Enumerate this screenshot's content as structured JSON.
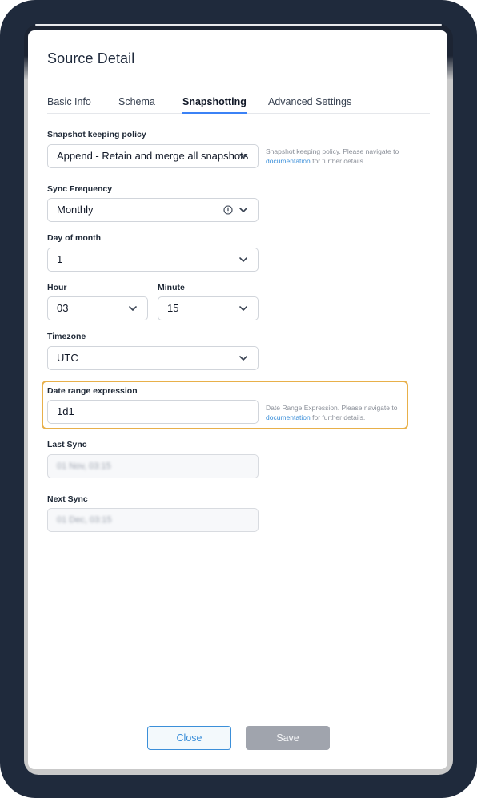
{
  "modal": {
    "title": "Source Detail",
    "tabs": [
      {
        "label": "Basic Info",
        "active": false
      },
      {
        "label": "Schema",
        "active": false
      },
      {
        "label": "Snapshotting",
        "active": true
      },
      {
        "label": "Advanced Settings",
        "active": false
      }
    ]
  },
  "form": {
    "snapshot_policy": {
      "label": "Snapshot keeping policy",
      "value": "Append - Retain and merge all snapshots",
      "help_text": "Snapshot keeping policy. Please navigate to",
      "help_link": "documentation",
      "help_suffix": " for further details."
    },
    "sync_frequency": {
      "label": "Sync Frequency",
      "value": "Monthly",
      "icon": "info-circle-icon"
    },
    "day_of_month": {
      "label": "Day of month",
      "value": "1"
    },
    "hour": {
      "label": "Hour",
      "value": "03"
    },
    "minute": {
      "label": "Minute",
      "value": "15"
    },
    "timezone": {
      "label": "Timezone",
      "value": "UTC"
    },
    "date_range_expression": {
      "label": "Date range expression",
      "value": "1d1",
      "help_text": "Date Range Expression. Please navigate to",
      "help_link": "documentation",
      "help_suffix": " for further details.",
      "highlight_color": "#e8b04a"
    },
    "last_sync": {
      "label": "Last Sync",
      "value": "01 Nov, 03:15"
    },
    "next_sync": {
      "label": "Next Sync",
      "value": "01 Dec, 03:15"
    }
  },
  "footer": {
    "close_label": "Close",
    "save_label": "Save"
  },
  "colors": {
    "frame": "#1f2a3c",
    "accent": "#3b8fd9",
    "tab_underline": "#3b82f6",
    "save_disabled": "#a0a4ad"
  }
}
